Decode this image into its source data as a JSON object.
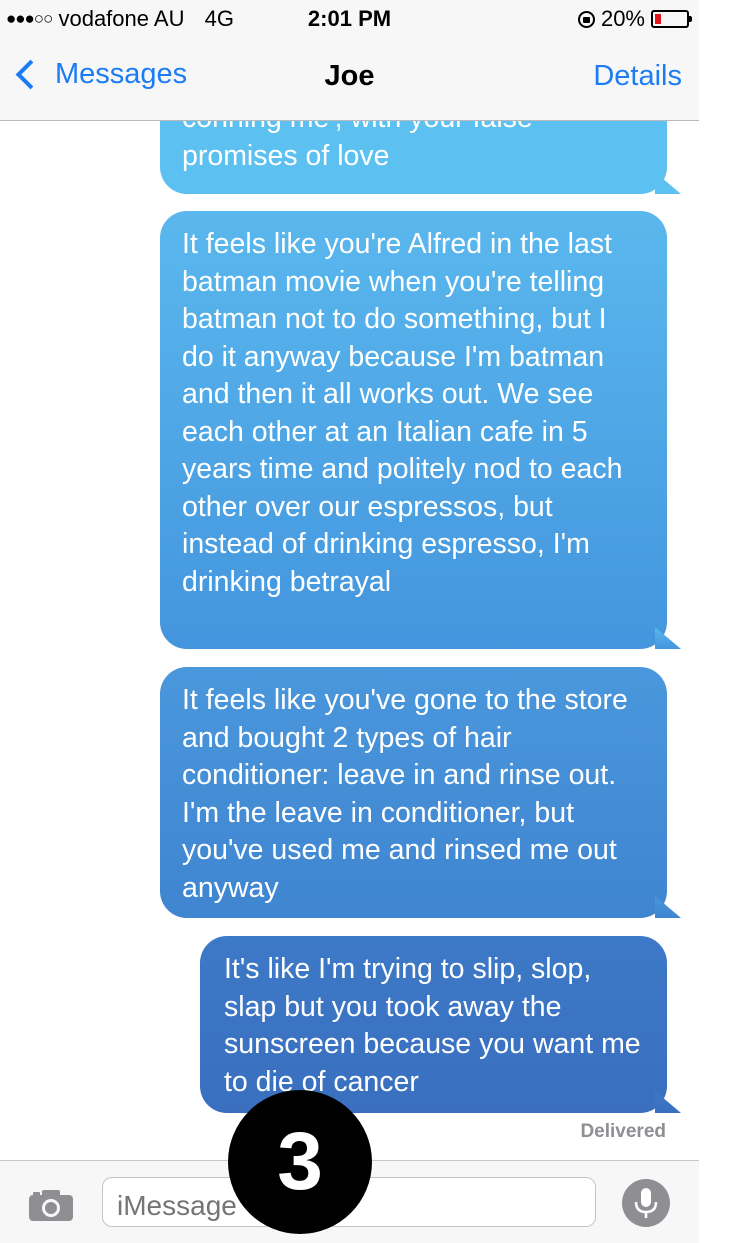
{
  "status_bar": {
    "signal_dots": "●●●○○",
    "carrier": "vodafone AU",
    "network": "4G",
    "time": "2:01 PM",
    "battery_text": "20%",
    "battery_level": 0.2,
    "battery_color": "#e4151b"
  },
  "nav": {
    "back_label": "Messages",
    "title": "Joe",
    "details_label": "Details",
    "accent_color": "#1b7cf3"
  },
  "messages": [
    {
      "text": "conning me', with your false promises of love"
    },
    {
      "text": "It feels like you're Alfred in the last batman movie when you're telling batman not to do something, but I do it anyway because I'm batman and then it all works out. We see each other at an Italian cafe in 5 years time and politely nod to each other over our espressos, but instead of drinking espresso, I'm drinking betrayal"
    },
    {
      "text": "It feels like you've gone to the store and bought 2 types of hair conditioner: leave in and rinse out. I'm the leave in conditioner, but you've used me and rinsed me out anyway"
    },
    {
      "text": "It's like I'm trying to slip, slop, slap but you took away the sunscreen because you want me to die of cancer"
    }
  ],
  "delivery_status": "Delivered",
  "input": {
    "placeholder": "iMessage",
    "camera_icon": "camera-icon",
    "mic_icon": "microphone-icon"
  },
  "overlay": {
    "step_number": "3"
  }
}
